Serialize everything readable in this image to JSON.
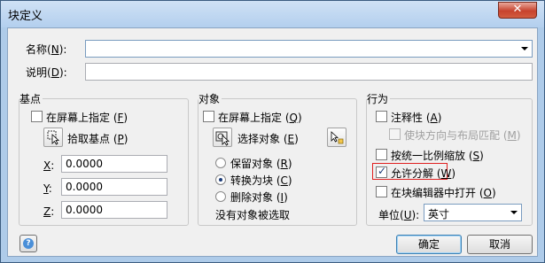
{
  "window": {
    "title": "块定义",
    "close_glyph": "✕"
  },
  "name_field": {
    "label": "名称",
    "hotkey": "N",
    "value": ""
  },
  "desc_field": {
    "label": "说明",
    "hotkey": "D",
    "value": ""
  },
  "base_point": {
    "title": "基点",
    "specify_on_screen": {
      "label": "在屏幕上指定",
      "hotkey": "F",
      "checked": false
    },
    "pick_button": {
      "label": "拾取基点",
      "hotkey": "P"
    },
    "x": {
      "label": "X",
      "value": "0.0000"
    },
    "y": {
      "label": "Y",
      "value": "0.0000"
    },
    "z": {
      "label": "Z",
      "value": "0.0000"
    }
  },
  "objects": {
    "title": "对象",
    "specify_on_screen": {
      "label": "在屏幕上指定",
      "hotkey": "Q",
      "checked": false
    },
    "select_button": {
      "label": "选择对象",
      "hotkey": "E"
    },
    "retain": {
      "label": "保留对象",
      "hotkey": "R",
      "selected": false
    },
    "convert": {
      "label": "转换为块",
      "hotkey": "C",
      "selected": true
    },
    "delete": {
      "label": "删除对象",
      "hotkey": "I",
      "selected": false
    },
    "status": "没有对象被选取"
  },
  "behavior": {
    "title": "行为",
    "annotative": {
      "label": "注释性",
      "hotkey": "A",
      "checked": false
    },
    "match_orientation": {
      "label": "使块方向与布局匹配",
      "hotkey": "M",
      "checked": false,
      "disabled": true
    },
    "scale_uniformly": {
      "label": "按统一比例缩放",
      "hotkey": "S",
      "checked": false
    },
    "allow_explode": {
      "label": "允许分解",
      "hotkey": "W",
      "checked": true
    },
    "open_in_editor": {
      "label": "在块编辑器中打开",
      "hotkey": "O",
      "checked": false
    },
    "unit": {
      "label": "单位",
      "hotkey": "U",
      "value": "英寸"
    }
  },
  "footer": {
    "ok_label": "确定",
    "cancel_label": "取消",
    "help_glyph": "?"
  }
}
